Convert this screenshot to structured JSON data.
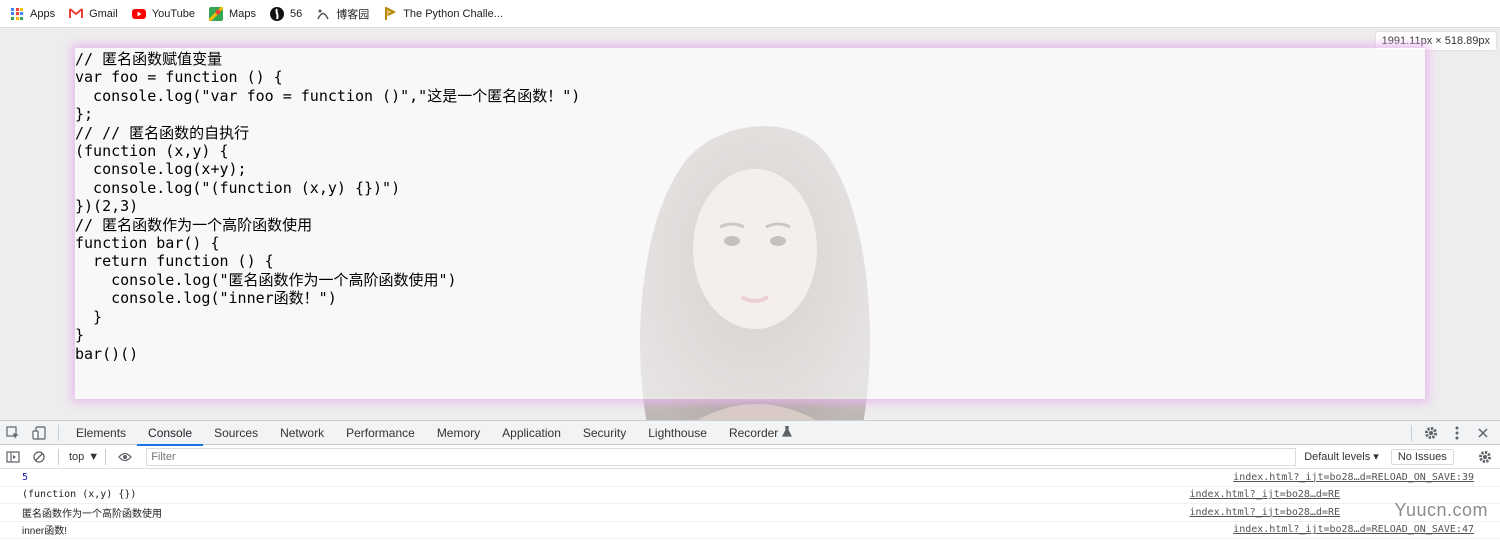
{
  "bookmarks": [
    {
      "label": "Apps",
      "icon": "apps-grid-icon"
    },
    {
      "label": "Gmail",
      "icon": "gmail-icon"
    },
    {
      "label": "YouTube",
      "icon": "youtube-icon"
    },
    {
      "label": "Maps",
      "icon": "maps-icon"
    },
    {
      "label": "56",
      "icon": "site-56-icon"
    },
    {
      "label": "博客园",
      "icon": "cnblogs-icon"
    },
    {
      "label": "The Python Challe...",
      "icon": "python-challenge-icon"
    }
  ],
  "viewport": {
    "size_badge": "1991.11px × 518.89px",
    "code": "// 匿名函数赋值变量\nvar foo = function () {\n  console.log(\"var foo = function ()\",\"这是一个匿名函数！\")\n};\n// // 匿名函数的自执行\n(function (x,y) {\n  console.log(x+y);\n  console.log(\"(function (x,y) {})\")\n})(2,3)\n// 匿名函数作为一个高阶函数使用\nfunction bar() {\n  return function () {\n    console.log(\"匿名函数作为一个高阶函数使用\")\n    console.log(\"inner函数！\")\n  }\n}\nbar()()"
  },
  "devtools": {
    "tabs": [
      "Elements",
      "Console",
      "Sources",
      "Network",
      "Performance",
      "Memory",
      "Application",
      "Security",
      "Lighthouse",
      "Recorder"
    ],
    "active_tab": "Console",
    "context": "top",
    "filter_placeholder": "Filter",
    "levels": "Default levels ▾",
    "issues": "No Issues",
    "console": [
      {
        "message": "5",
        "source": "index.html?_ijt=bo28…d=RELOAD_ON_SAVE:39"
      },
      {
        "message": "(function (x,y) {})",
        "source": "index.html?_ijt=bo28…d=RE"
      },
      {
        "message": "匿名函数作为一个高阶函数使用",
        "source": "index.html?_ijt=bo28…d=RE"
      },
      {
        "message": "inner函数!",
        "source": "index.html?_ijt=bo28…d=RELOAD_ON_SAVE:47"
      }
    ]
  },
  "watermark": "Yuucn.com",
  "colors": {
    "accent": "#1a73e8",
    "glow": "#e9b7ee",
    "number": "#1a1aa6"
  }
}
